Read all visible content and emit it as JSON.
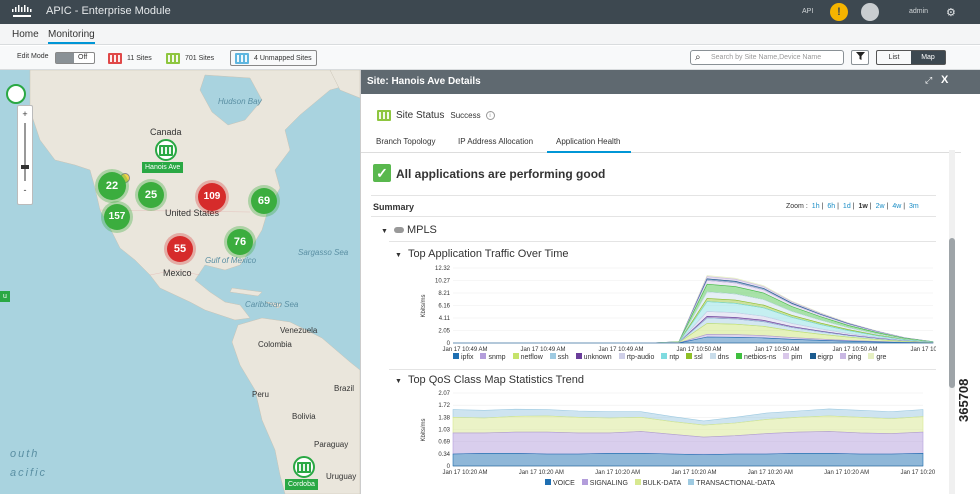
{
  "header": {
    "app_title": "APIC - Enterprise Module",
    "api_label": "API",
    "notification_glyph": "!",
    "user": "admin"
  },
  "nav": {
    "home": "Home",
    "monitoring": "Monitoring"
  },
  "toolbar": {
    "edit_mode_label": "Edit Mode",
    "toggle_state": "Off",
    "red_sites": "11 Sites",
    "green_sites": "701 Sites",
    "unmapped_sites": "4 Unmapped Sites",
    "search_placeholder": "Search by Site Name,Device Name",
    "list_label": "List",
    "map_label": "Map"
  },
  "map": {
    "labels": [
      "Hudson Bay",
      "Canada",
      "United States",
      "Gulf of Mexico",
      "Mexico",
      "Caribbean Sea",
      "Sargasso Sea",
      "Venezuela",
      "Colombia",
      "Peru",
      "Brazil",
      "Bolivia",
      "Paraguay",
      "Uruguay",
      "outh",
      "acific"
    ],
    "clusters": [
      {
        "value": "22",
        "color": "#3bad3e"
      },
      {
        "value": "25",
        "color": "#3bad3e"
      },
      {
        "value": "157",
        "color": "#3bad3e"
      },
      {
        "value": "109",
        "color": "#d62b2b"
      },
      {
        "value": "69",
        "color": "#3bad3e"
      },
      {
        "value": "55",
        "color": "#d62b2b"
      },
      {
        "value": "76",
        "color": "#3bad3e"
      }
    ],
    "site_hanois": "Hanois Ave",
    "site_cordoba": "Cordoba",
    "edge_label": "u",
    "zoom_in": "+",
    "zoom_out": "-"
  },
  "panel": {
    "title": "Site: Hanois Ave Details",
    "close": "X",
    "site_status_label": "Site Status",
    "site_status_value": "Success",
    "tabs": [
      "Branch Topology",
      "IP Address Allocation",
      "Application Health"
    ],
    "all_ok": "All applications are performing good",
    "summary": "Summary",
    "zoom_prefix": "Zoom :",
    "zoom_options": [
      "1h",
      "6h",
      "1d",
      "1w",
      "2w",
      "4w",
      "3m"
    ],
    "zoom_selected": "1w",
    "mpls": "MPLS",
    "chart1_title": "Top Application Traffic Over Time",
    "chart2_title": "Top QoS Class Map Statistics Trend"
  },
  "chart_data": [
    {
      "type": "area",
      "title": "Top Application Traffic Over Time",
      "ylabel": "Kbits/ms",
      "yticks": [
        "12.32",
        "10.27",
        "8.21",
        "6.16",
        "4.11",
        "2.05",
        "0"
      ],
      "ylim": [
        0,
        12.32
      ],
      "xticks": [
        "Jan 17 10:49 AM",
        "Jan 17 10:49 AM",
        "Jan 17 10:49 AM",
        "Jan 17 10:50 AM",
        "Jan 17 10:50 AM",
        "Jan 17 10:50 AM",
        "Jan 17 10:50 AM"
      ],
      "series": [
        {
          "name": "ipfix",
          "color": "#1f6fb2"
        },
        {
          "name": "snmp",
          "color": "#b39ddb"
        },
        {
          "name": "netflow",
          "color": "#c6e36b"
        },
        {
          "name": "ssh",
          "color": "#9ecae1"
        },
        {
          "name": "unknown",
          "color": "#6a3d9a"
        },
        {
          "name": "rtp-audio",
          "color": "#cfcfe8"
        },
        {
          "name": "ntp",
          "color": "#7fdbe0"
        },
        {
          "name": "ssl",
          "color": "#8fbf26"
        },
        {
          "name": "dns",
          "color": "#c8dcea"
        },
        {
          "name": "netbios-ns",
          "color": "#3fbf3f"
        },
        {
          "name": "pim",
          "color": "#d9c7ea"
        },
        {
          "name": "eigrp",
          "color": "#1c5b8f"
        },
        {
          "name": "ping",
          "color": "#c9b7e3"
        },
        {
          "name": "gre",
          "color": "#e6f0c2"
        }
      ],
      "profile": [
        0,
        0,
        0,
        0,
        0,
        0,
        0,
        0,
        0.02,
        1,
        0.96,
        0.85,
        0.62,
        0.45,
        0.3,
        0.18,
        0.08,
        0.02
      ],
      "stack_peaks": [
        1.1,
        0.5,
        2.0,
        1.0,
        0.3,
        0.9,
        1.8,
        0.6,
        1.2,
        1.4,
        0.7,
        0.3,
        0.4,
        0.2
      ]
    },
    {
      "type": "area",
      "title": "Top QoS Class Map Statistics Trend",
      "ylabel": "Kbits/ms",
      "yticks": [
        "2.07",
        "1.72",
        "1.38",
        "1.03",
        "0.69",
        "0.34",
        "0"
      ],
      "ylim": [
        0,
        2.07
      ],
      "xticks": [
        "Jan 17 10:20 AM",
        "Jan 17 10:20 AM",
        "Jan 17 10:20 AM",
        "Jan 17 10:20 AM",
        "Jan 17 10:20 AM",
        "Jan 17 10:20 AM",
        "Jan 17 10:20 AM"
      ],
      "series": [
        {
          "name": "VOICE",
          "color": "#1f6fb2",
          "values": [
            0.34,
            0.36,
            0.36,
            0.34,
            0.34,
            0.36,
            0.36,
            0.34,
            0.32,
            0.34,
            0.34,
            0.36,
            0.36,
            0.34,
            0.34,
            0.36
          ]
        },
        {
          "name": "SIGNALING",
          "color": "#b39ddb",
          "values": [
            0.6,
            0.58,
            0.6,
            0.62,
            0.6,
            0.58,
            0.62,
            0.56,
            0.5,
            0.52,
            0.58,
            0.6,
            0.62,
            0.6,
            0.58,
            0.6
          ]
        },
        {
          "name": "BULK-DATA",
          "color": "#d7e88f",
          "values": [
            0.44,
            0.42,
            0.45,
            0.46,
            0.44,
            0.42,
            0.4,
            0.36,
            0.34,
            0.36,
            0.4,
            0.42,
            0.44,
            0.44,
            0.42,
            0.44
          ]
        },
        {
          "name": "TRANSACTIONAL-DATA",
          "color": "#9ecae1",
          "values": [
            0.22,
            0.22,
            0.2,
            0.18,
            0.18,
            0.18,
            0.16,
            0.14,
            0.12,
            0.16,
            0.18,
            0.18,
            0.2,
            0.2,
            0.2,
            0.2
          ]
        }
      ]
    }
  ],
  "figure_id": "365708"
}
